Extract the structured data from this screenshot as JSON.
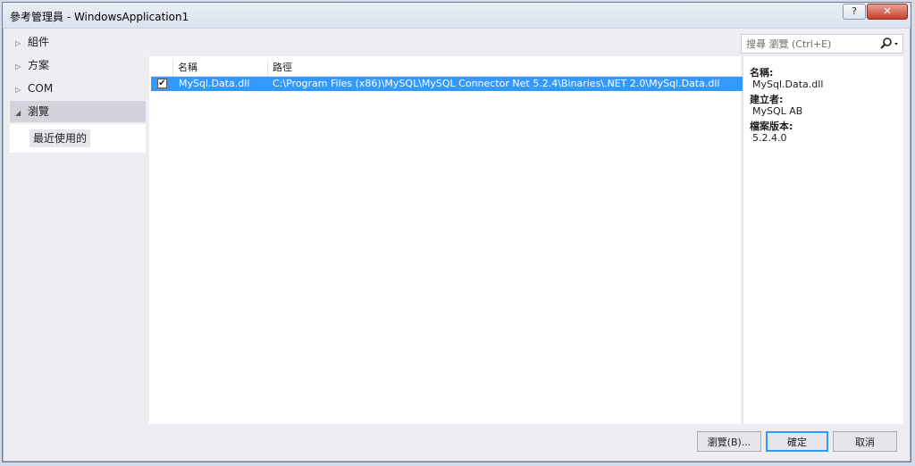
{
  "window": {
    "title": "參考管理員 - WindowsApplication1",
    "help_label": "?",
    "close_label": "✕"
  },
  "nav": {
    "items": [
      {
        "label": "組件",
        "arrow": "▷"
      },
      {
        "label": "方案",
        "arrow": "▷"
      },
      {
        "label": "COM",
        "arrow": "▷"
      },
      {
        "label": "瀏覽",
        "arrow": "◢"
      }
    ],
    "subitems": [
      {
        "label": "最近使用的"
      }
    ]
  },
  "search": {
    "placeholder": "搜尋 瀏覽 (Ctrl+E)"
  },
  "list": {
    "columns": [
      "名稱",
      "路徑"
    ],
    "rows": [
      {
        "checked": true,
        "check_mark": "✔",
        "name": "MySql.Data.dll",
        "path": "C:\\Program Files (x86)\\MySQL\\MySQL Connector Net 5.2.4\\Binaries\\.NET 2.0\\MySql.Data.dll"
      }
    ]
  },
  "details": {
    "name_label": "名稱:",
    "name_value": "MySql.Data.dll",
    "creator_label": "建立者:",
    "creator_value": "MySQL AB",
    "version_label": "檔案版本:",
    "version_value": "5.2.4.0"
  },
  "buttons": {
    "browse": "瀏覽(B)...",
    "ok": "確定",
    "cancel": "取消"
  },
  "colors": {
    "selection": "#3399ff",
    "close_button": "#c7402b"
  }
}
